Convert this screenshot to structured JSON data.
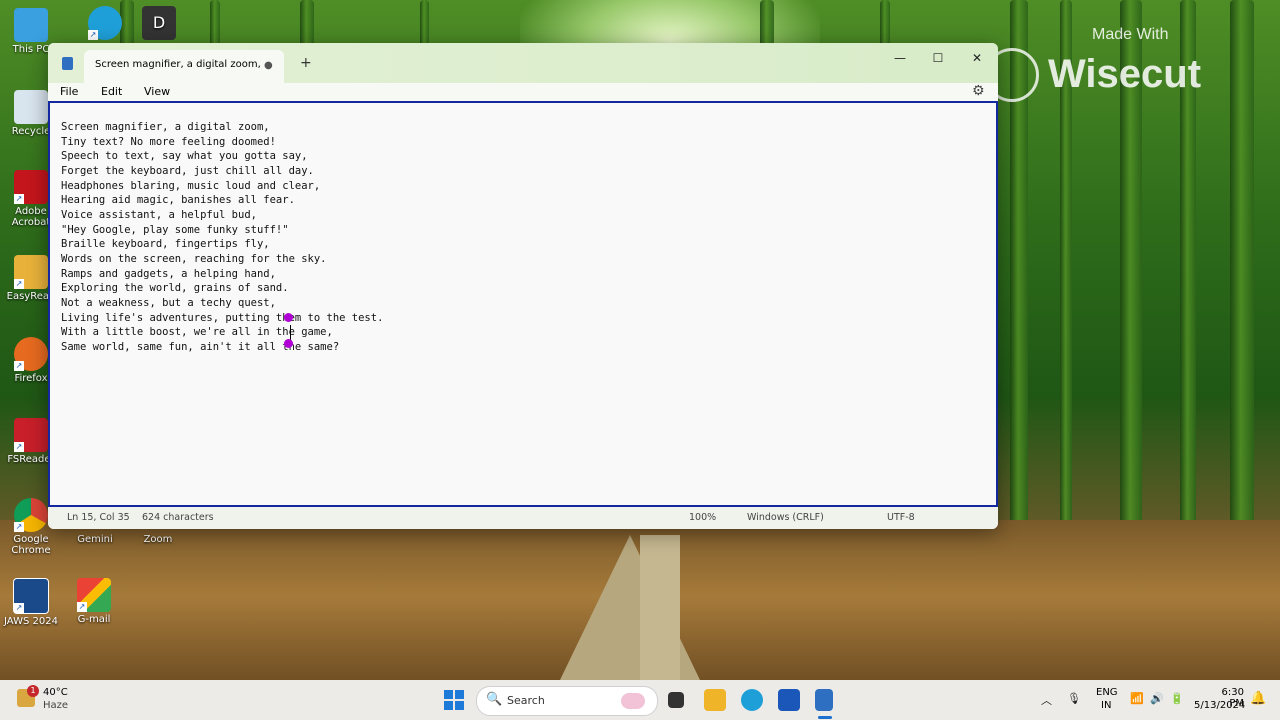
{
  "desktop": {
    "icons": [
      {
        "label": "This PC"
      },
      {
        "label": "Recycle"
      },
      {
        "label": "Adobe Acrobat"
      },
      {
        "label": "EasyRead"
      },
      {
        "label": "Firefox"
      },
      {
        "label": "FSReader"
      },
      {
        "label": "Google Chrome"
      },
      {
        "label": "Gemini"
      },
      {
        "label": "Zoom"
      },
      {
        "label": "JAWS 2024"
      },
      {
        "label": "G-mail"
      },
      {
        "label": "D"
      }
    ]
  },
  "watermark": {
    "line1": "Made With",
    "line2": "Wisecut"
  },
  "notepad": {
    "tab_title": "Screen magnifier, a digital zoom,",
    "unsaved_dot": "●",
    "new_tab": "+",
    "controls": {
      "minimize": "—",
      "maximize": "☐",
      "close": "✕"
    },
    "menu": {
      "file": "File",
      "edit": "Edit",
      "view": "View"
    },
    "settings_glyph": "⚙",
    "lines": [
      "Screen magnifier, a digital zoom,",
      "Tiny text? No more feeling doomed!",
      "Speech to text, say what you gotta say,",
      "Forget the keyboard, just chill all day.",
      "Headphones blaring, music loud and clear,",
      "Hearing aid magic, banishes all fear.",
      "Voice assistant, a helpful bud,",
      "\"Hey Google, play some funky stuff!\"",
      "Braille keyboard, fingertips fly,",
      "Words on the screen, reaching for the sky.",
      "Ramps and gadgets, a helping hand,",
      "Exploring the world, grains of sand.",
      "Not a weakness, but a techy quest,",
      "Living life's adventures, putting them to the test.",
      "With a little boost, we're all in the game,",
      "Same world, same fun, ain't it all the same?"
    ],
    "status": {
      "position": "Ln 15, Col 35",
      "characters": "624 characters",
      "zoom": "100%",
      "line_ending": "Windows (CRLF)",
      "encoding": "UTF-8"
    },
    "accent_color": "#1428a0",
    "selection_handle_color": "#b000d6"
  },
  "taskbar": {
    "weather": {
      "badge": "1",
      "temp": "40°C",
      "desc": "Haze"
    },
    "search_label": "Search",
    "search_glyph": "🔍",
    "tray": {
      "chevron": "︿",
      "mic": "🎙",
      "lang_line1": "ENG",
      "lang_line2": "IN",
      "wifi": "📶",
      "volume": "🔊",
      "battery": "🔋",
      "time": "6:30 PM",
      "date": "5/13/2024",
      "bell": "🔔"
    }
  }
}
